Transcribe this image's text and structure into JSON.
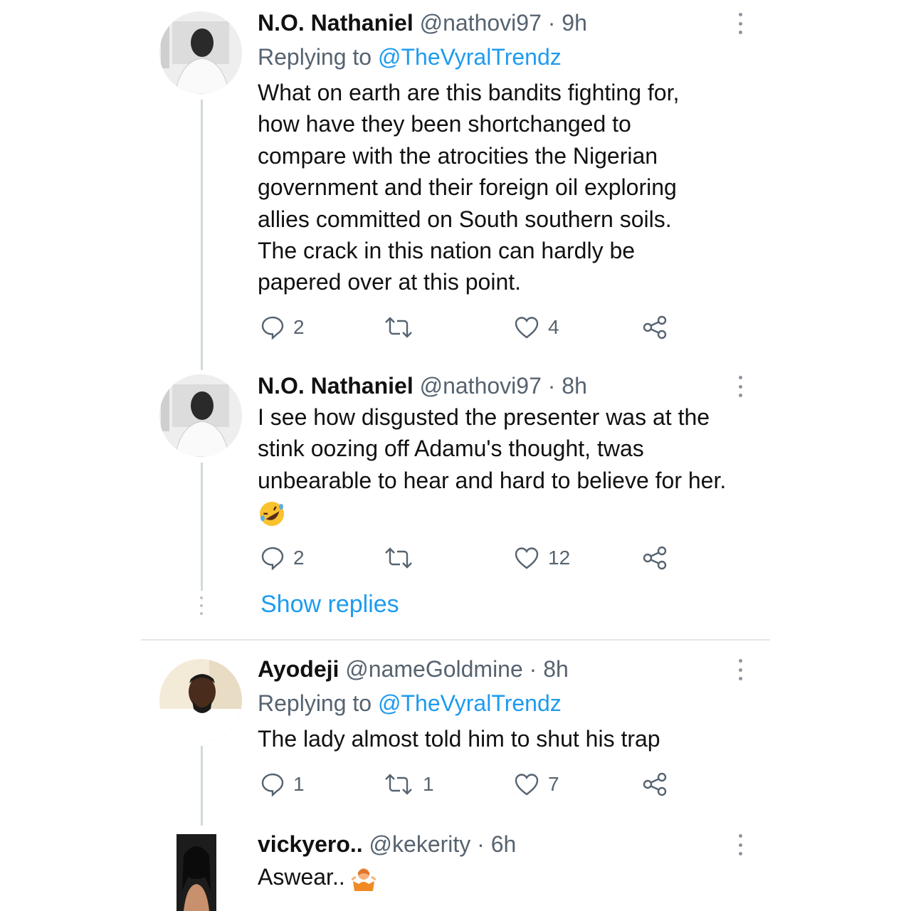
{
  "tweets": [
    {
      "name": "N.O. Nathaniel",
      "handle": "@nathovi97",
      "time": "· 9h",
      "replying_prefix": "Replying to",
      "replying_handle": "@TheVyralTrendz",
      "text_lines": [
        "What on earth are this bandits fighting for,",
        "how have they been shortchanged to",
        "compare with the atrocities the Nigerian",
        "government and their foreign oil exploring",
        "allies  committed on South southern soils.",
        "The crack in this nation can hardly be",
        "papered over at this point."
      ],
      "reply_count": "2",
      "retweet_count": "",
      "like_count": "4"
    },
    {
      "name": "N.O. Nathaniel",
      "handle": "@nathovi97",
      "time": "· 8h",
      "text_lines": [
        "I see how disgusted the presenter was at the",
        "stink oozing off Adamu's thought, twas",
        "unbearable to hear and hard to believe for her."
      ],
      "emoji": "rolling-on-floor-laughing",
      "reply_count": "2",
      "retweet_count": "",
      "like_count": "12",
      "show_replies": "Show replies"
    },
    {
      "name": "Ayodeji",
      "handle": "@nameGoldmine",
      "time": "· 8h",
      "replying_prefix": "Replying to",
      "replying_handle": "@TheVyralTrendz",
      "text": "The lady almost told him to shut his trap",
      "reply_count": "1",
      "retweet_count": "1",
      "like_count": "7"
    },
    {
      "name": "vickyero..",
      "handle": "@kekerity",
      "time": "· 6h",
      "text": "Aswear..",
      "emoji": "person-shrugging"
    }
  ],
  "icons": {
    "reply": "reply-icon",
    "retweet": "retweet-icon",
    "like": "heart-icon",
    "share": "share-icon",
    "more": "more-vertical-icon"
  },
  "colors": {
    "link": "#1d9bf0",
    "meta": "#566370",
    "thread_line": "#cfd9de"
  }
}
